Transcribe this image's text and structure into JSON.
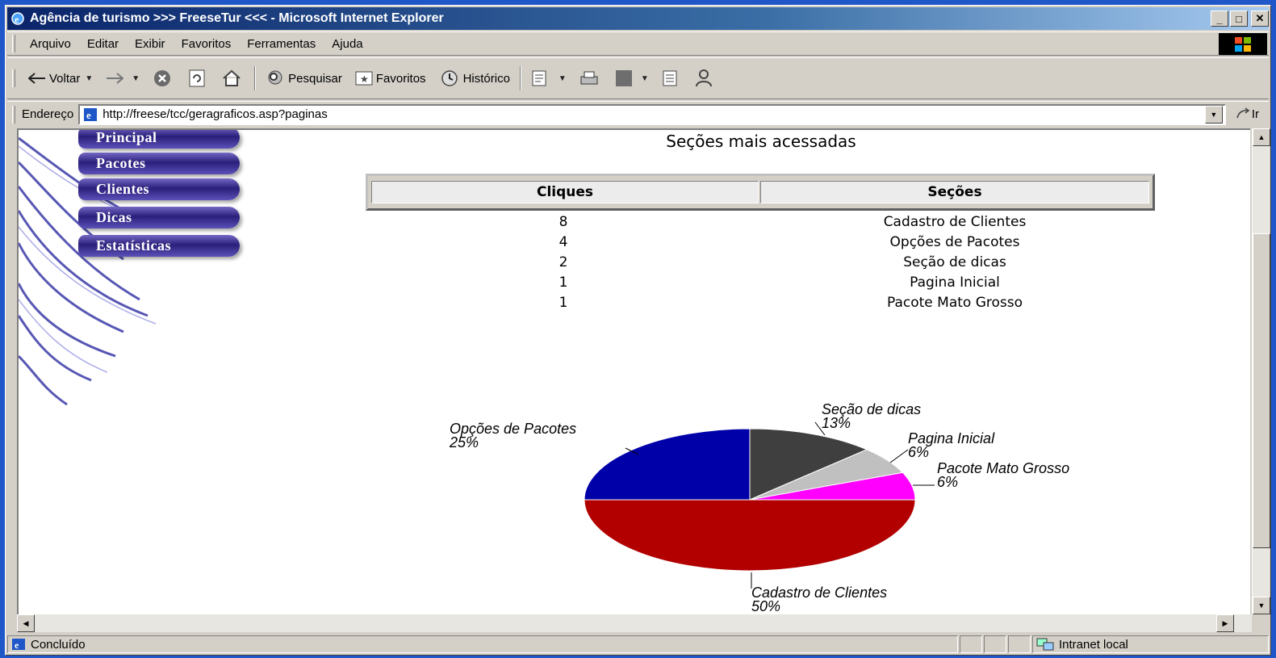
{
  "window": {
    "title": "Agência de turismo >>> FreeseTur <<< - Microsoft Internet Explorer",
    "minimize": "_",
    "maximize": "□",
    "close": "✕"
  },
  "menu": {
    "items": [
      "Arquivo",
      "Editar",
      "Exibir",
      "Favoritos",
      "Ferramentas",
      "Ajuda"
    ]
  },
  "toolbar": {
    "back_label": "Voltar",
    "search_label": "Pesquisar",
    "favorites_label": "Favoritos",
    "history_label": "Histórico"
  },
  "address": {
    "label": "Endereço",
    "url": "http://freese/tcc/geragraficos.asp?paginas",
    "go_label": "Ir"
  },
  "sidebar": {
    "items": [
      "Principal",
      "Pacotes",
      "Clientes",
      "Dicas",
      "Estatísticas"
    ]
  },
  "page": {
    "title": "Seções mais acessadas",
    "table": {
      "headers": [
        "Cliques",
        "Seções"
      ],
      "rows": [
        {
          "clicks": "8",
          "section": "Cadastro de Clientes"
        },
        {
          "clicks": "4",
          "section": "Opções de Pacotes"
        },
        {
          "clicks": "2",
          "section": "Seção de dicas"
        },
        {
          "clicks": "1",
          "section": "Pagina Inicial"
        },
        {
          "clicks": "1",
          "section": "Pacote Mato Grosso"
        }
      ]
    }
  },
  "chart_data": {
    "type": "pie",
    "title": "",
    "slices": [
      {
        "name": "Seção de dicas",
        "value": 2,
        "percent_label": "13%",
        "color": "#3f3f3f"
      },
      {
        "name": "Pagina Inicial",
        "value": 1,
        "percent_label": "6%",
        "color": "#c0c0c0"
      },
      {
        "name": "Pacote Mato Grosso",
        "value": 1,
        "percent_label": "6%",
        "color": "#ff00ff"
      },
      {
        "name": "Cadastro de Clientes",
        "value": 8,
        "percent_label": "50%",
        "color": "#b20000"
      },
      {
        "name": "Opções de Pacotes",
        "value": 4,
        "percent_label": "25%",
        "color": "#0000a8"
      }
    ]
  },
  "status": {
    "text": "Concluído",
    "zone": "Intranet local"
  },
  "colors": {
    "desktop": "#1f56c8",
    "titlebar": "#0a246a",
    "nav_button": "#2a1f7a"
  }
}
